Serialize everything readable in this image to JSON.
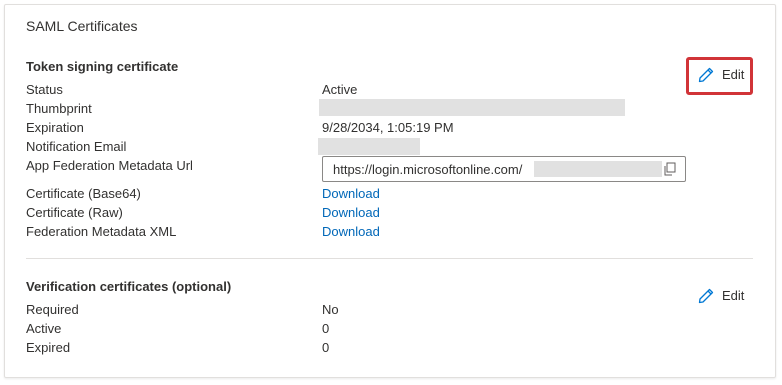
{
  "card": {
    "title": "SAML Certificates"
  },
  "token_signing": {
    "title": "Token signing certificate",
    "edit_label": "Edit",
    "rows": {
      "status": {
        "label": "Status",
        "value": "Active"
      },
      "thumbprint": {
        "label": "Thumbprint"
      },
      "expiration": {
        "label": "Expiration",
        "value": "9/28/2034, 1:05:19 PM"
      },
      "notification_email": {
        "label": "Notification Email"
      },
      "metadata_url": {
        "label": "App Federation Metadata Url",
        "value": "https://login.microsoftonline.com/"
      },
      "cert_base64": {
        "label": "Certificate (Base64)",
        "link": "Download"
      },
      "cert_raw": {
        "label": "Certificate (Raw)",
        "link": "Download"
      },
      "federation_xml": {
        "label": "Federation Metadata XML",
        "link": "Download"
      }
    }
  },
  "verification": {
    "title": "Verification certificates (optional)",
    "edit_label": "Edit",
    "rows": {
      "required": {
        "label": "Required",
        "value": "No"
      },
      "active": {
        "label": "Active",
        "value": "0"
      },
      "expired": {
        "label": "Expired",
        "value": "0"
      }
    }
  },
  "colors": {
    "link": "#0067b8",
    "highlight": "#d13438",
    "icon": "#0078d4"
  },
  "icons": [
    "pencil-icon",
    "copy-icon"
  ]
}
